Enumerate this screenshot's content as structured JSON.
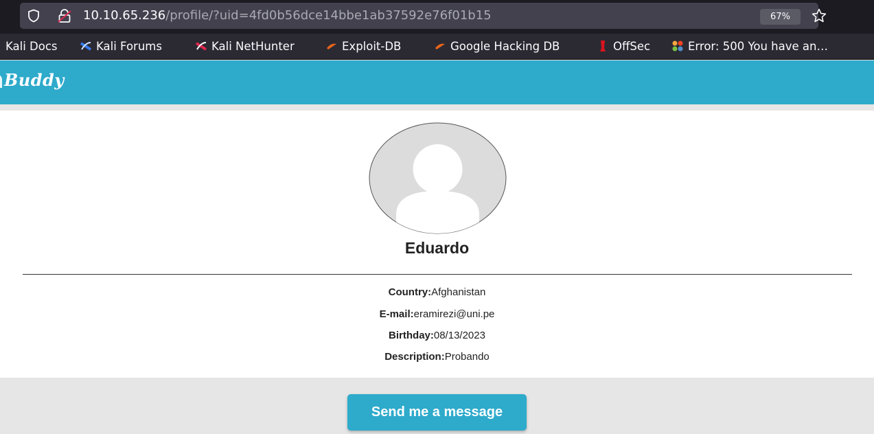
{
  "browser": {
    "url_host": "10.10.65.236",
    "url_path": "/profile/?uid=4fd0b56dce14bbe1ab37592e76f01b15",
    "zoom": "67%",
    "icons": {
      "shield": "shield-icon",
      "lock": "lock-insecure-icon",
      "star": "star-icon"
    }
  },
  "bookmarks": [
    {
      "label": "Kali Docs",
      "icon": "kali-docs-icon"
    },
    {
      "label": "Kali Forums",
      "icon": "kali-forums-icon"
    },
    {
      "label": "Kali NetHunter",
      "icon": "kali-nethunter-icon"
    },
    {
      "label": "Exploit-DB",
      "icon": "exploit-db-icon"
    },
    {
      "label": "Google Hacking DB",
      "icon": "google-hacking-db-icon"
    },
    {
      "label": "OffSec",
      "icon": "offsec-icon"
    },
    {
      "label": "Error: 500 You have an…",
      "icon": "joomla-icon"
    }
  ],
  "site": {
    "brand": "Buddy"
  },
  "profile": {
    "name": "Eduardo",
    "avatar_icon": "default-avatar-icon",
    "fields": [
      {
        "key": "Country:",
        "value": "Afghanistan"
      },
      {
        "key": "E-mail:",
        "value": "eramirezi@uni.pe"
      },
      {
        "key": "Birthday:",
        "value": "08/13/2023"
      },
      {
        "key": "Description:",
        "value": "Probando"
      }
    ]
  },
  "actions": {
    "send_message_label": "Send me a message"
  },
  "colors": {
    "brand_accent": "#2eaacb",
    "page_background": "#e6e6e6",
    "card_background": "#ffffff",
    "chrome_dark": "#1c1b22"
  }
}
